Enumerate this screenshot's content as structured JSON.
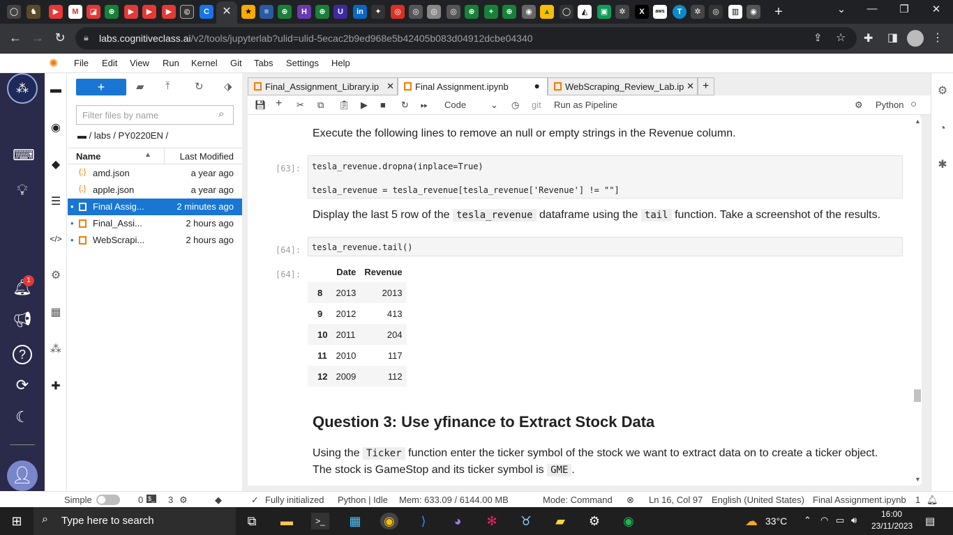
{
  "browser": {
    "url_host": "labs.cognitiveclass.ai",
    "url_path": "/v2/tools/jupyterlab?ulid=ulid-5ecac2b9ed968e5b42405b083d04912dcbe04340",
    "active_tab_icon": "close-icon",
    "new_tab": "+"
  },
  "menu": [
    "File",
    "Edit",
    "View",
    "Run",
    "Kernel",
    "Git",
    "Tabs",
    "Settings",
    "Help"
  ],
  "filebrowser": {
    "new_label": "+",
    "filter_placeholder": "Filter files by name",
    "breadcrumb": "/ labs / PY0220EN /",
    "col_name": "Name",
    "col_modified": "Last Modified",
    "files": [
      {
        "name": "amd.json",
        "modified": "a year ago",
        "icon": "{;}"
      },
      {
        "name": "apple.json",
        "modified": "a year ago",
        "icon": "{;}"
      },
      {
        "name": "Final Assig...",
        "modified": "2 minutes ago",
        "icon": "notebook"
      },
      {
        "name": "Final_Assi...",
        "modified": "2 hours ago",
        "icon": "notebook"
      },
      {
        "name": "WebScrapi...",
        "modified": "2 hours ago",
        "icon": "notebook"
      }
    ]
  },
  "doc_tabs": [
    {
      "label": "Final_Assignment_Library.ip"
    },
    {
      "label": "Final Assignment.ipynb"
    },
    {
      "label": "WebScraping_Review_Lab.ip"
    }
  ],
  "nb_toolbar": {
    "cell_type": "Code",
    "git": "git",
    "pipeline": "Run as Pipeline",
    "kernel": "Python"
  },
  "notebook": {
    "md1": "Execute the following lines to remove an null or empty strings in the Revenue column.",
    "p63": "[63]:",
    "code63_line1": "tesla_revenue.dropna(inplace=True)",
    "code63_line2": "tesla_revenue = tesla_revenue[tesla_revenue['Revenue'] != \"\"]",
    "md2_a": "Display the last 5 row of the",
    "md2_code1": "tesla_revenue",
    "md2_b": "dataframe using the",
    "md2_code2": "tail",
    "md2_c": "function. Take a screenshot of the results.",
    "p64": "[64]:",
    "code64": "tesla_revenue.tail()",
    "out64": "[64]:",
    "df_head": [
      "",
      "Date",
      "Revenue"
    ],
    "df_rows": [
      {
        "idx": "8",
        "date": "2013",
        "rev": "2013"
      },
      {
        "idx": "9",
        "date": "2012",
        "rev": "413"
      },
      {
        "idx": "10",
        "date": "2011",
        "rev": "204"
      },
      {
        "idx": "11",
        "date": "2010",
        "rev": "117"
      },
      {
        "idx": "12",
        "date": "2009",
        "rev": "112"
      }
    ],
    "q3": "Question 3: Use yfinance to Extract Stock Data",
    "md3_a": "Using the",
    "md3_code": "Ticker",
    "md3_b": "function enter the ticker symbol of the stock we want to extract data on to create a ticker object.",
    "md4_a": "The stock is GameStop and its ticker symbol is",
    "md4_code": "GME",
    "md4_b": "."
  },
  "status": {
    "mode": "Simple",
    "terminals": "0",
    "kernels": "3",
    "init": "Fully initialized",
    "kernel": "Python | Idle",
    "mem": "Mem: 633.09 / 6144.00 MB",
    "cmd_mode": "Mode: Command",
    "pos": "Ln 16, Col 97",
    "lang": "English (United States)",
    "file": "Final Assignment.ipynb",
    "notif": "1"
  },
  "taskbar": {
    "search": "Type here to search",
    "weather": "33°C",
    "time": "16:00",
    "date": "23/11/2023",
    "badge": "1"
  },
  "colors": {
    "accent": "#1976d2",
    "activity": "#2a2a4a",
    "notebook_icon": "#f57c00"
  }
}
